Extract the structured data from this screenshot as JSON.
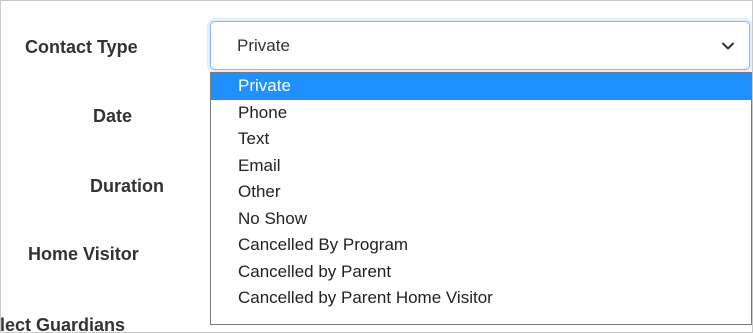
{
  "form": {
    "labels": {
      "contact_type": "Contact Type",
      "date": "Date",
      "duration": "Duration",
      "home_visitor": "Home Visitor",
      "select_guardians": "lect Guardians"
    },
    "contact_type_select": {
      "value": "Private",
      "options": [
        "Private",
        "Phone",
        "Text",
        "Email",
        "Other",
        "No Show",
        "Cancelled By Program",
        "Cancelled by Parent",
        "Cancelled by Parent Home Visitor"
      ]
    }
  },
  "colors": {
    "selected_option_bg": "#1e90ff",
    "focus_border": "#86b7fe"
  }
}
